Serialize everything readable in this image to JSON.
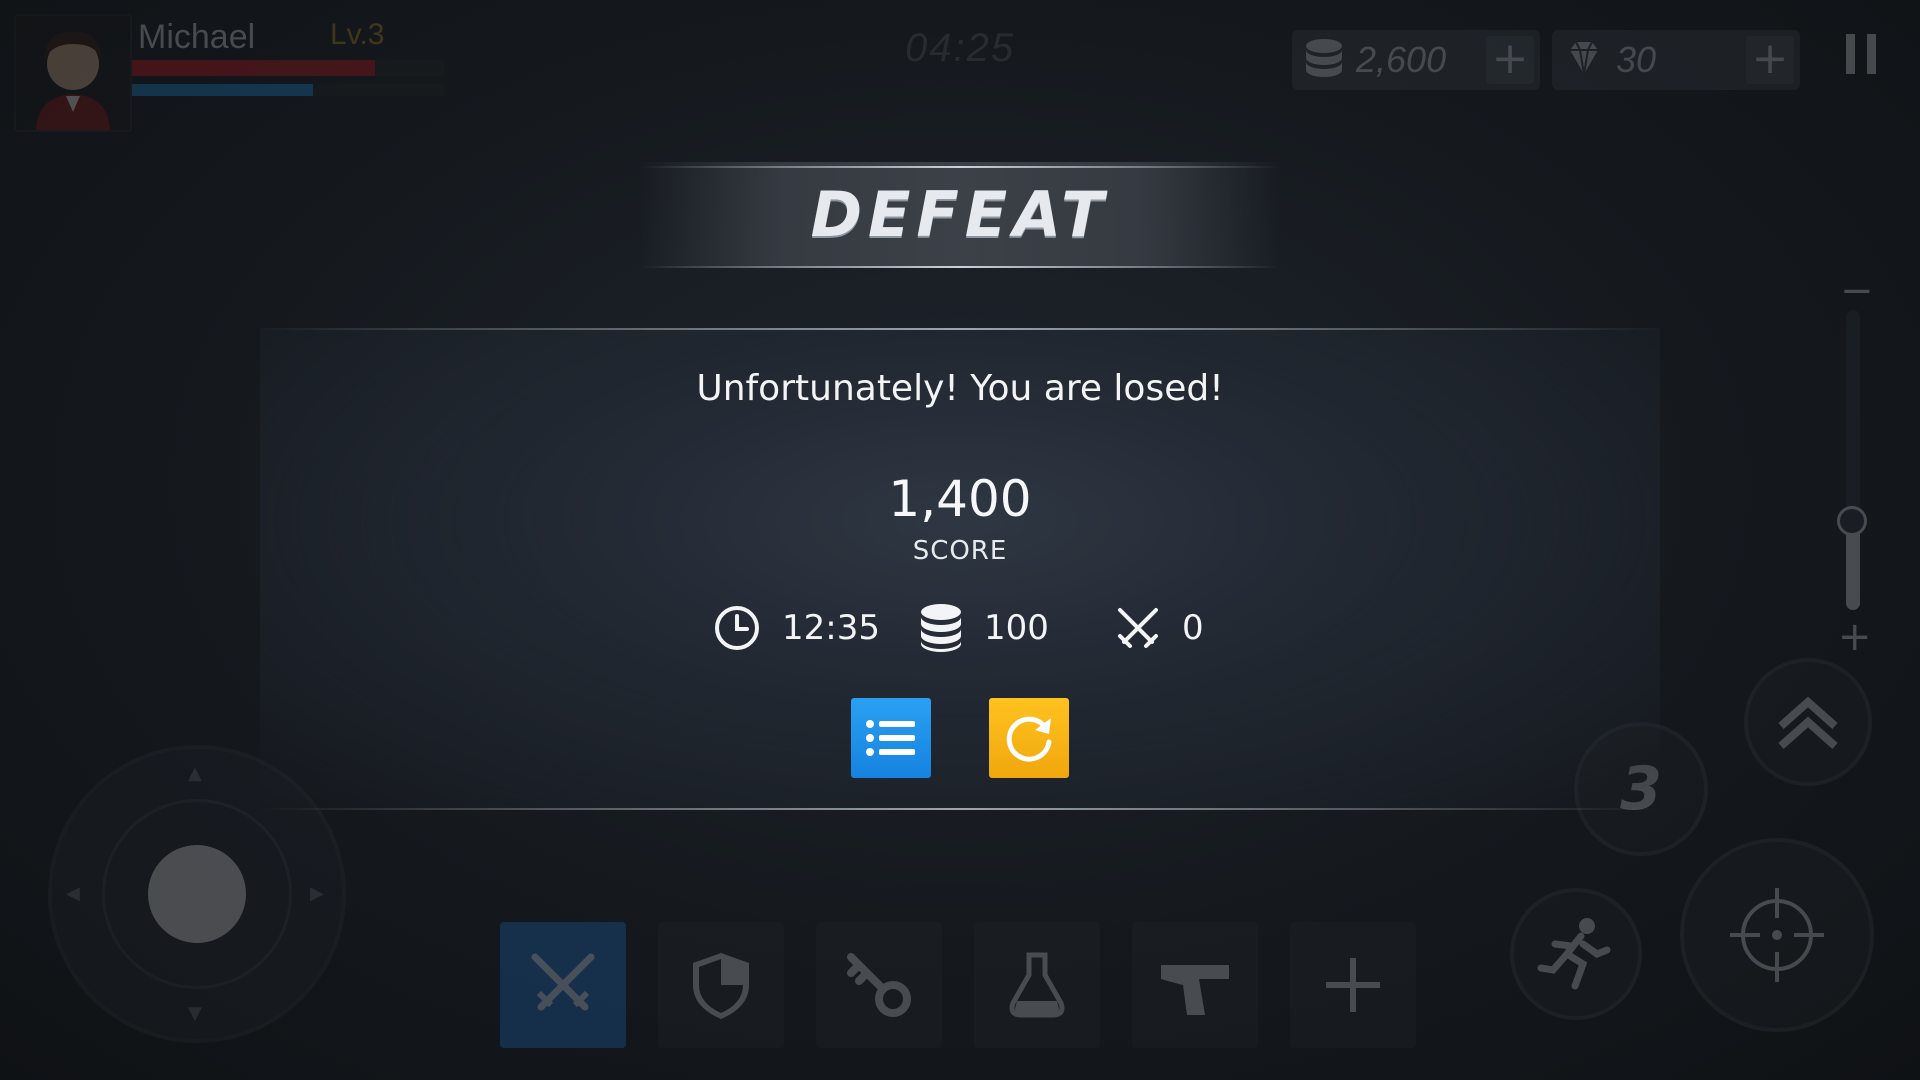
{
  "hud": {
    "player_name": "Michael",
    "player_level": "Lv.3",
    "hp_fraction": 0.78,
    "mp_fraction": 0.58,
    "timer": "04:25",
    "gold": "2,600",
    "gems": "30",
    "currency_plus": "+",
    "skill_charge": "3"
  },
  "result": {
    "title": "DEFEAT",
    "message": "Unfortunately! You are losed!",
    "score_value": "1,400",
    "score_label": "SCORE",
    "time": "12:35",
    "coins": "100",
    "kills": "0"
  },
  "colors": {
    "list_button": "#1f8ee8",
    "retry_button": "#f7b517",
    "hp_bar": "#c0161c",
    "mp_bar": "#1c86c9"
  },
  "icons": {
    "stats": [
      "clock-icon",
      "coin-stack-icon",
      "crossed-swords-icon"
    ],
    "buttons": [
      "list-icon",
      "retry-icon"
    ],
    "hotbar": [
      "crossed-swords-icon",
      "shield-icon",
      "key-icon",
      "potion-icon",
      "pistol-icon",
      "plus-icon"
    ]
  }
}
